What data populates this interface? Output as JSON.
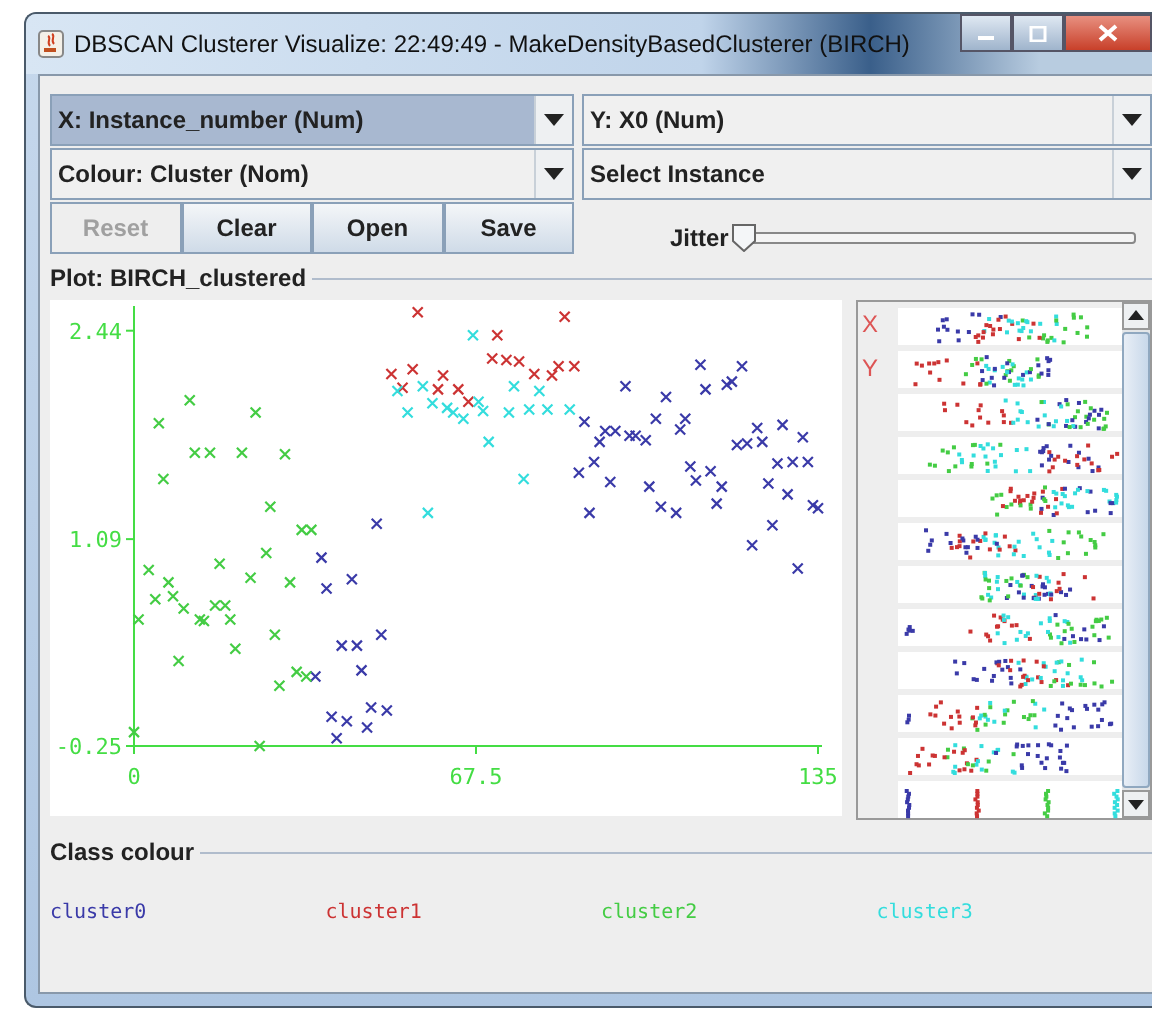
{
  "window": {
    "title": "DBSCAN Clusterer Visualize: 22:49:49 - MakeDensityBasedClusterer (BIRCH)"
  },
  "combos": [
    {
      "label": "X: Instance_number (Num)",
      "selected": true
    },
    {
      "label": "Y: X0 (Num)",
      "selected": false
    },
    {
      "label": "Colour: Cluster (Nom)",
      "selected": false
    },
    {
      "label": "Select Instance",
      "selected": false
    }
  ],
  "buttons": [
    {
      "label": "Reset",
      "disabled": true
    },
    {
      "label": "Clear",
      "disabled": false
    },
    {
      "label": "Open",
      "disabled": false
    },
    {
      "label": "Save",
      "disabled": false
    }
  ],
  "jitter": {
    "label": "Jitter",
    "level": 0
  },
  "plot": {
    "title": "Plot: BIRCH_clustered",
    "chart_data": {
      "type": "scatter",
      "xlim": [
        0,
        135
      ],
      "ylim": [
        -0.25,
        2.6
      ],
      "xticks": [
        {
          "value": 0,
          "label": "0"
        },
        {
          "value": 67.5,
          "label": "67.5"
        },
        {
          "value": 135,
          "label": "135"
        }
      ],
      "yticks": [
        {
          "value": -0.25,
          "label": "-0.25"
        },
        {
          "value": 1.09,
          "label": "1.09"
        },
        {
          "value": 2.44,
          "label": "2.44"
        }
      ],
      "series": [
        {
          "name": "cluster0",
          "color": "#3a3aa8",
          "x": [
            37,
            38,
            35.8,
            39,
            40,
            41,
            42,
            43,
            44,
            44.9,
            46,
            46.8,
            47.9,
            48.8,
            49.9,
            87.8,
            88.9,
            89.9,
            90.8,
            91.9,
            93,
            94,
            95,
            97,
            97.8,
            99,
            101,
            101.7,
            103,
            104,
            105,
            107,
            107.8,
            108.8,
            109.8,
            110.9,
            111.8,
            112.8,
            113.8,
            115,
            116,
            117,
            118,
            119,
            120,
            121,
            122,
            123,
            124,
            125.2,
            126,
            127,
            128,
            129,
            130,
            131,
            132,
            133,
            134,
            135
          ],
          "values": [
            0.97,
            0.77,
            0.2,
            -0.06,
            -0.2,
            0.4,
            -0.09,
            0.83,
            0.4,
            0.24,
            -0.13,
            0,
            1.19,
            0.47,
            -0.02,
            1.52,
            1.85,
            1.26,
            1.59,
            1.72,
            1.79,
            1.46,
            1.79,
            2.08,
            1.76,
            1.76,
            1.73,
            1.43,
            1.87,
            1.3,
            2.01,
            1.26,
            1.8,
            1.87,
            1.56,
            1.47,
            2.22,
            2.06,
            1.53,
            1.32,
            1.43,
            2.09,
            2.11,
            1.7,
            2.21,
            1.71,
            1.05,
            1.81,
            1.72,
            1.45,
            1.18,
            1.58,
            1.83,
            1.38,
            1.59,
            0.9,
            1.75,
            1.59,
            1.31,
            1.29
          ]
        },
        {
          "name": "cluster1",
          "color": "#cc3333",
          "x": [
            50.8,
            53,
            55,
            56,
            60,
            61,
            64,
            66,
            70.7,
            71.7,
            73.5,
            76,
            79,
            82.5,
            83.8,
            85,
            86.9
          ],
          "values": [
            2.16,
            2.07,
            2.19,
            2.56,
            2.06,
            2.15,
            2.06,
            1.98,
            2.26,
            2.41,
            2.25,
            2.24,
            2.16,
            2.15,
            2.21,
            2.53,
            2.21
          ]
        },
        {
          "name": "cluster2",
          "color": "#44cc44",
          "x": [
            0,
            0.9,
            2.9,
            4.2,
            4.9,
            5.8,
            6.8,
            7.7,
            8.8,
            9.8,
            11,
            12,
            13,
            13.8,
            15,
            16,
            16.9,
            18,
            19,
            20,
            21.3,
            23,
            24,
            24.8,
            26.1,
            26.9,
            27.8,
            28.7,
            29.8,
            30.8,
            32.1,
            33.1,
            34,
            35
          ],
          "values": [
            -0.16,
            0.57,
            0.89,
            0.7,
            1.84,
            1.48,
            0.81,
            0.72,
            0.3,
            0.64,
            1.99,
            1.65,
            0.57,
            0.56,
            1.65,
            0.66,
            0.93,
            0.66,
            0.57,
            0.38,
            1.65,
            0.84,
            1.91,
            -0.25,
            1,
            1.3,
            0.47,
            0.14,
            1.64,
            0.81,
            0.23,
            1.15,
            0.2,
            1.15
          ]
        },
        {
          "name": "cluster3",
          "color": "#33dddd",
          "x": [
            52,
            54,
            57,
            58,
            58.9,
            61.8,
            63,
            65,
            66.9,
            68,
            68.9,
            70,
            74,
            75,
            76.9,
            78,
            80,
            81.6,
            86
          ],
          "values": [
            2.05,
            1.91,
            2.08,
            1.26,
            1.97,
            1.94,
            1.91,
            1.87,
            2.41,
            1.98,
            1.92,
            1.72,
            1.91,
            2.08,
            1.48,
            1.93,
            2.05,
            1.93,
            1.93
          ]
        }
      ]
    }
  },
  "matrix": {
    "labels": [
      "X",
      "Y"
    ]
  },
  "class_colour": {
    "title": "Class colour"
  }
}
